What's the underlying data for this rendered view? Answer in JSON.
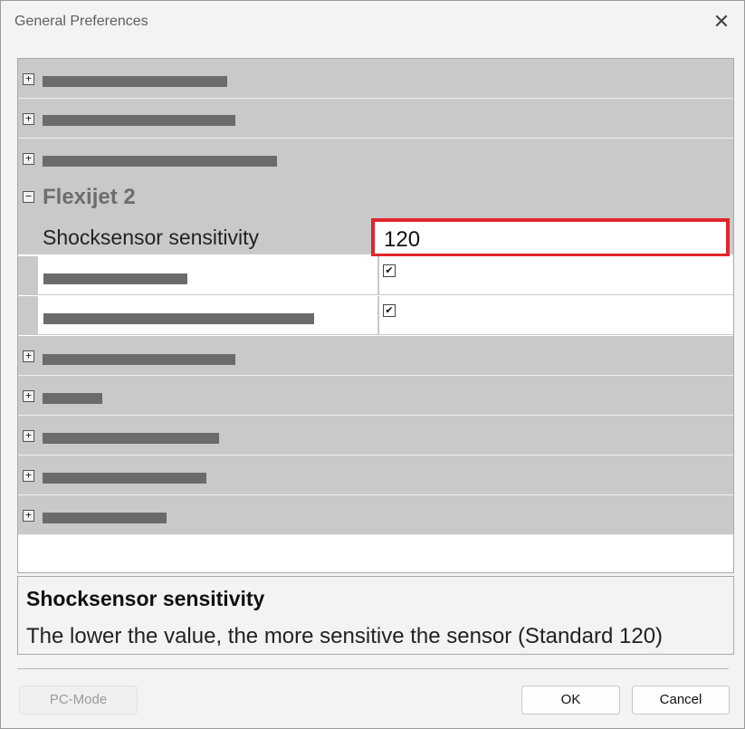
{
  "window": {
    "title": "General Preferences",
    "close_glyph": "✕"
  },
  "grid": {
    "collapsed_glyph": "+",
    "expanded_glyph": "−",
    "expanded_category": {
      "title": "Flexijet 2",
      "property": {
        "name": "Shocksensor sensitivity",
        "value": "120"
      },
      "checkbox_rows": [
        {
          "checked": true
        },
        {
          "checked": true
        }
      ]
    }
  },
  "description": {
    "title": "Shocksensor sensitivity",
    "text": "The lower the value, the more sensitive the sensor (Standard 120)"
  },
  "footer": {
    "pc_mode_label": "PC-Mode",
    "ok_label": "OK",
    "cancel_label": "Cancel"
  },
  "check_glyph": "✔"
}
